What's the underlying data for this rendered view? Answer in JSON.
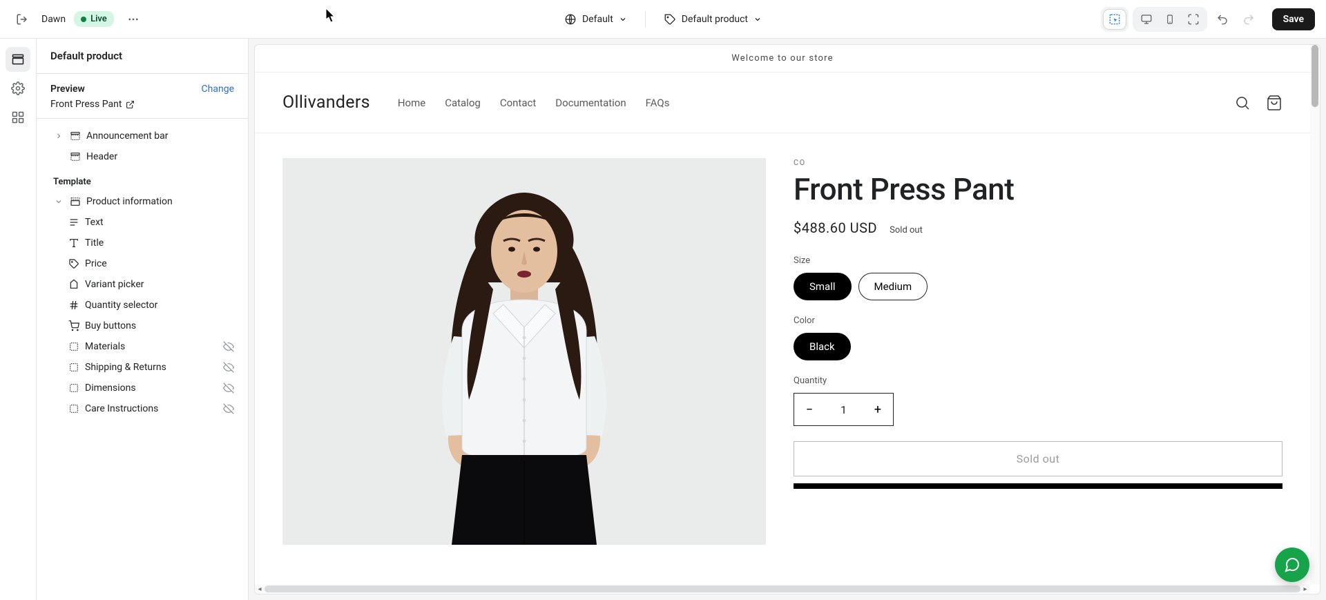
{
  "topbar": {
    "theme_name": "Dawn",
    "status_label": "Live",
    "locale_label": "Default",
    "template_label": "Default product",
    "save_label": "Save"
  },
  "sidebar": {
    "title": "Default product",
    "preview_label": "Preview",
    "change_label": "Change",
    "preview_product": "Front Press Pant",
    "template_group_label": "Template",
    "sections": {
      "announce": "Announcement bar",
      "header": "Header",
      "product_info": "Product information"
    },
    "blocks": {
      "text": "Text",
      "title": "Title",
      "price": "Price",
      "variant_picker": "Variant picker",
      "quantity": "Quantity selector",
      "buy": "Buy buttons",
      "materials": "Materials",
      "shipping": "Shipping & Returns",
      "dimensions": "Dimensions",
      "care": "Care Instructions"
    }
  },
  "store": {
    "announce": "Welcome to our store",
    "logo": "Ollivanders",
    "nav": {
      "home": "Home",
      "catalog": "Catalog",
      "contact": "Contact",
      "docs": "Documentation",
      "faqs": "FAQs"
    },
    "product": {
      "vendor": "CO",
      "title": "Front Press Pant",
      "price": "$488.60 USD",
      "soldout": "Sold out",
      "size_label": "Size",
      "size_small": "Small",
      "size_medium": "Medium",
      "color_label": "Color",
      "color_black": "Black",
      "qty_label": "Quantity",
      "qty_value": "1",
      "buy_label": "Sold out"
    }
  }
}
